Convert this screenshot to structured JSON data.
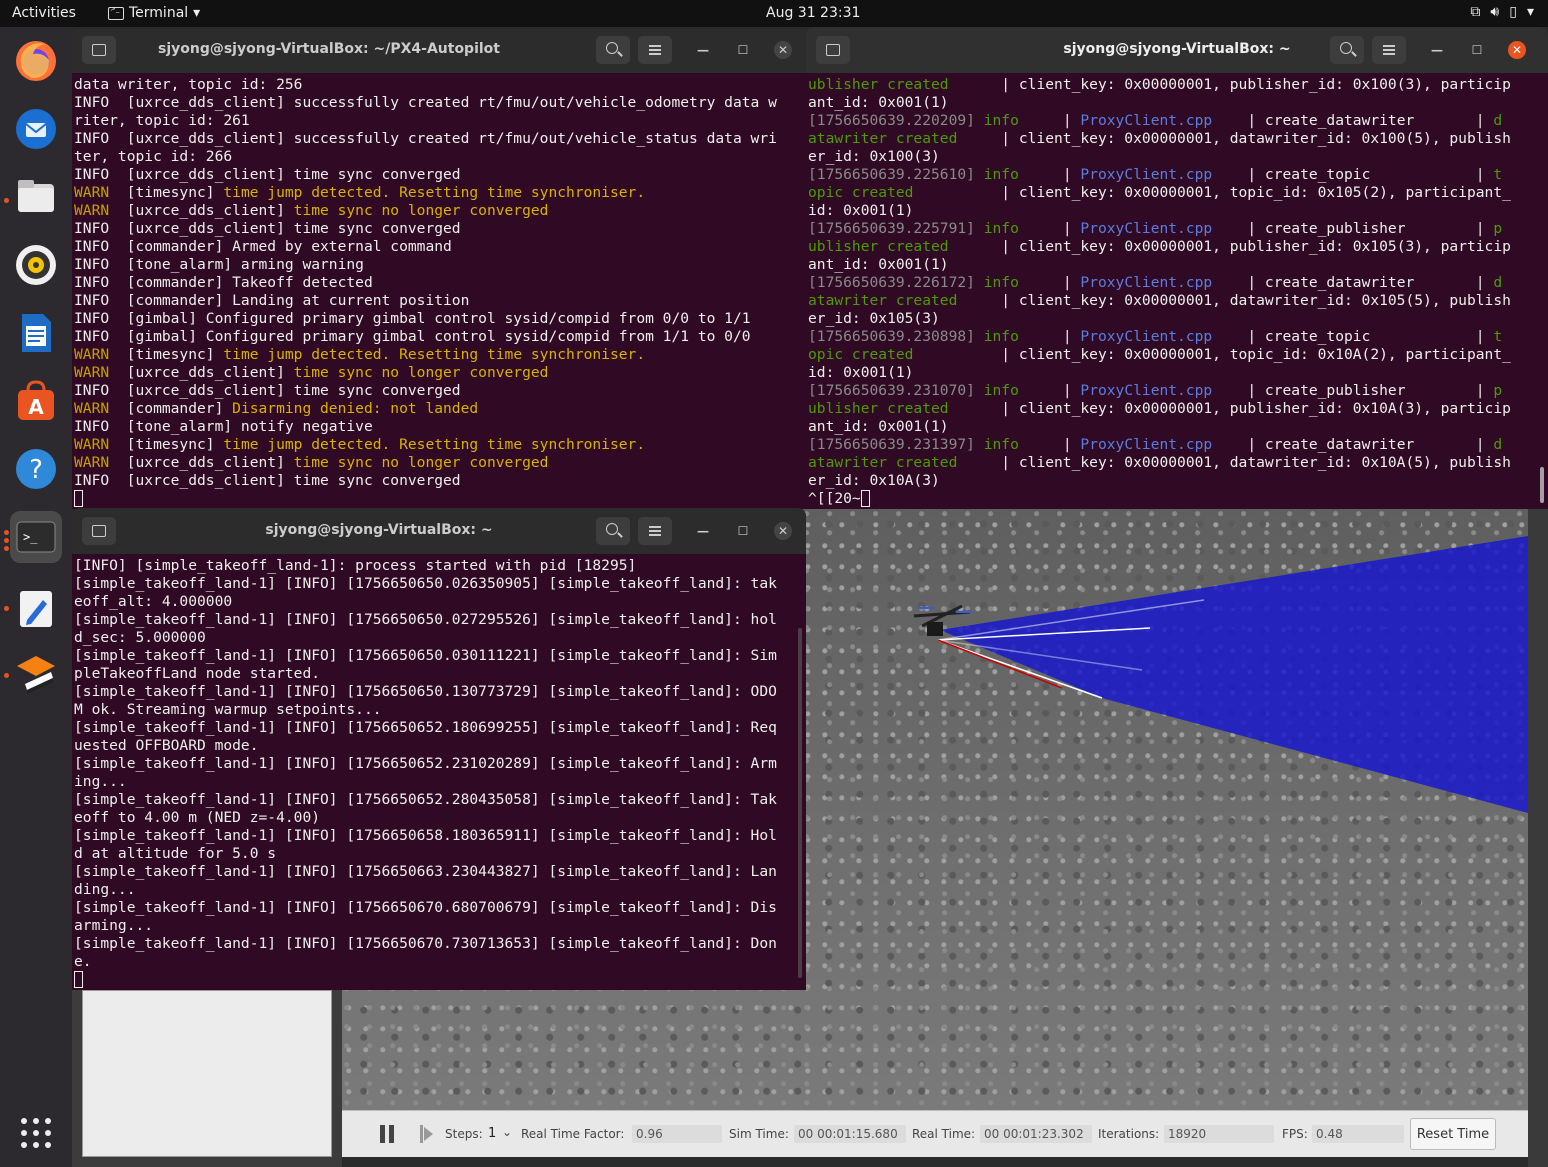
{
  "topbar": {
    "activities": "Activities",
    "app_menu": "Terminal",
    "clock": "Aug 31  23:31"
  },
  "dock": {
    "items": [
      "firefox-icon",
      "thunderbird-icon",
      "files-icon",
      "rhythmbox-icon",
      "libreoffice-writer-icon",
      "app-center-icon",
      "help-icon",
      "terminal-icon",
      "text-editor-icon",
      "gazebo-icon",
      "show-apps-icon"
    ]
  },
  "term1": {
    "title": "sjyong@sjyong-VirtualBox: ~/PX4-Autopilot",
    "lines": [
      [
        {
          "t": "data writer, topic id: 256"
        }
      ],
      [
        {
          "t": "INFO  [uxrce_dds_client] successfully created rt/fmu/out/vehicle_odometry data w"
        }
      ],
      [
        {
          "t": "riter, topic id: 261"
        }
      ],
      [
        {
          "t": "INFO  [uxrce_dds_client] successfully created rt/fmu/out/vehicle_status data wri"
        }
      ],
      [
        {
          "t": "ter, topic id: 266"
        }
      ],
      [
        {
          "t": "INFO  [uxrce_dds_client] time sync converged"
        }
      ],
      [
        {
          "t": "WARN  ",
          "c": "w"
        },
        {
          "t": "[timesync] "
        },
        {
          "t": "time jump detected. Resetting time synchroniser.",
          "c": "y"
        }
      ],
      [
        {
          "t": "WARN  ",
          "c": "w"
        },
        {
          "t": "[uxrce_dds_client] "
        },
        {
          "t": "time sync no longer converged",
          "c": "y"
        }
      ],
      [
        {
          "t": "INFO  [uxrce_dds_client] time sync converged"
        }
      ],
      [
        {
          "t": "INFO  [commander] Armed by external command"
        }
      ],
      [
        {
          "t": "INFO  [tone_alarm] arming warning"
        }
      ],
      [
        {
          "t": "INFO  [commander] Takeoff detected"
        }
      ],
      [
        {
          "t": "INFO  [commander] Landing at current position"
        }
      ],
      [
        {
          "t": "INFO  [gimbal] Configured primary gimbal control sysid/compid from 0/0 to 1/1"
        }
      ],
      [
        {
          "t": "INFO  [gimbal] Configured primary gimbal control sysid/compid from 1/1 to 0/0"
        }
      ],
      [
        {
          "t": "WARN  ",
          "c": "w"
        },
        {
          "t": "[timesync] "
        },
        {
          "t": "time jump detected. Resetting time synchroniser.",
          "c": "y"
        }
      ],
      [
        {
          "t": "WARN  ",
          "c": "w"
        },
        {
          "t": "[uxrce_dds_client] "
        },
        {
          "t": "time sync no longer converged",
          "c": "y"
        }
      ],
      [
        {
          "t": "INFO  [uxrce_dds_client] time sync converged"
        }
      ],
      [
        {
          "t": "WARN  ",
          "c": "w"
        },
        {
          "t": "[commander] "
        },
        {
          "t": "Disarming denied: not landed",
          "c": "y"
        }
      ],
      [
        {
          "t": "INFO  [tone_alarm] notify negative"
        }
      ],
      [
        {
          "t": "WARN  ",
          "c": "w"
        },
        {
          "t": "[timesync] "
        },
        {
          "t": "time jump detected. Resetting time synchroniser.",
          "c": "y"
        }
      ],
      [
        {
          "t": "WARN  ",
          "c": "w"
        },
        {
          "t": "[uxrce_dds_client] "
        },
        {
          "t": "time sync no longer converged",
          "c": "y"
        }
      ],
      [
        {
          "t": "INFO  [uxrce_dds_client] time sync converged"
        }
      ]
    ]
  },
  "term2": {
    "title": "sjyong@sjyong-VirtualBox: ~",
    "lines": [
      [
        {
          "t": "ublisher created",
          "c": "gn"
        },
        {
          "t": "      | client_key: 0x00000001, publisher_id: 0x100(3), particip"
        }
      ],
      [
        {
          "t": "ant_id: 0x001(1)"
        }
      ],
      [
        {
          "t": "[1756650639.220209]",
          "c": "g"
        },
        {
          "t": " "
        },
        {
          "t": "info",
          "c": "gn"
        },
        {
          "t": "     | "
        },
        {
          "t": "ProxyClient.cpp",
          "c": "bl"
        },
        {
          "t": "    | create_datawriter       | "
        },
        {
          "t": "d",
          "c": "gn"
        }
      ],
      [
        {
          "t": "atawriter created",
          "c": "gn"
        },
        {
          "t": "     | client_key: 0x00000001, datawriter_id: 0x100(5), publish"
        }
      ],
      [
        {
          "t": "er_id: 0x100(3)"
        }
      ],
      [
        {
          "t": "[1756650639.225610]",
          "c": "g"
        },
        {
          "t": " "
        },
        {
          "t": "info",
          "c": "gn"
        },
        {
          "t": "     | "
        },
        {
          "t": "ProxyClient.cpp",
          "c": "bl"
        },
        {
          "t": "    | create_topic            | "
        },
        {
          "t": "t",
          "c": "gn"
        }
      ],
      [
        {
          "t": "opic created",
          "c": "gn"
        },
        {
          "t": "          | client_key: 0x00000001, topic_id: 0x105(2), participant_"
        }
      ],
      [
        {
          "t": "id: 0x001(1)"
        }
      ],
      [
        {
          "t": "[1756650639.225791]",
          "c": "g"
        },
        {
          "t": " "
        },
        {
          "t": "info",
          "c": "gn"
        },
        {
          "t": "     | "
        },
        {
          "t": "ProxyClient.cpp",
          "c": "bl"
        },
        {
          "t": "    | create_publisher        | "
        },
        {
          "t": "p",
          "c": "gn"
        }
      ],
      [
        {
          "t": "ublisher created",
          "c": "gn"
        },
        {
          "t": "      | client_key: 0x00000001, publisher_id: 0x105(3), particip"
        }
      ],
      [
        {
          "t": "ant_id: 0x001(1)"
        }
      ],
      [
        {
          "t": "[1756650639.226172]",
          "c": "g"
        },
        {
          "t": " "
        },
        {
          "t": "info",
          "c": "gn"
        },
        {
          "t": "     | "
        },
        {
          "t": "ProxyClient.cpp",
          "c": "bl"
        },
        {
          "t": "    | create_datawriter       | "
        },
        {
          "t": "d",
          "c": "gn"
        }
      ],
      [
        {
          "t": "atawriter created",
          "c": "gn"
        },
        {
          "t": "     | client_key: 0x00000001, datawriter_id: 0x105(5), publish"
        }
      ],
      [
        {
          "t": "er_id: 0x105(3)"
        }
      ],
      [
        {
          "t": "[1756650639.230898]",
          "c": "g"
        },
        {
          "t": " "
        },
        {
          "t": "info",
          "c": "gn"
        },
        {
          "t": "     | "
        },
        {
          "t": "ProxyClient.cpp",
          "c": "bl"
        },
        {
          "t": "    | create_topic            | "
        },
        {
          "t": "t",
          "c": "gn"
        }
      ],
      [
        {
          "t": "opic created",
          "c": "gn"
        },
        {
          "t": "          | client_key: 0x00000001, topic_id: 0x10A(2), participant_"
        }
      ],
      [
        {
          "t": "id: 0x001(1)"
        }
      ],
      [
        {
          "t": "[1756650639.231070]",
          "c": "g"
        },
        {
          "t": " "
        },
        {
          "t": "info",
          "c": "gn"
        },
        {
          "t": "     | "
        },
        {
          "t": "ProxyClient.cpp",
          "c": "bl"
        },
        {
          "t": "    | create_publisher        | "
        },
        {
          "t": "p",
          "c": "gn"
        }
      ],
      [
        {
          "t": "ublisher created",
          "c": "gn"
        },
        {
          "t": "      | client_key: 0x00000001, publisher_id: 0x10A(3), particip"
        }
      ],
      [
        {
          "t": "ant_id: 0x001(1)"
        }
      ],
      [
        {
          "t": "[1756650639.231397]",
          "c": "g"
        },
        {
          "t": " "
        },
        {
          "t": "info",
          "c": "gn"
        },
        {
          "t": "     | "
        },
        {
          "t": "ProxyClient.cpp",
          "c": "bl"
        },
        {
          "t": "    | create_datawriter       | "
        },
        {
          "t": "d",
          "c": "gn"
        }
      ],
      [
        {
          "t": "atawriter created",
          "c": "gn"
        },
        {
          "t": "     | client_key: 0x00000001, datawriter_id: 0x10A(5), publish"
        }
      ],
      [
        {
          "t": "er_id: 0x10A(3)"
        }
      ],
      [
        {
          "t": "^[[20~"
        }
      ]
    ]
  },
  "term3": {
    "title": "sjyong@sjyong-VirtualBox: ~",
    "lines": [
      [
        {
          "t": "[INFO] [simple_takeoff_land-1]: process started with pid [18295]"
        }
      ],
      [
        {
          "t": "[simple_takeoff_land-1] [INFO] [1756650650.026350905] [simple_takeoff_land]: tak"
        }
      ],
      [
        {
          "t": "eoff_alt: 4.000000"
        }
      ],
      [
        {
          "t": "[simple_takeoff_land-1] [INFO] [1756650650.027295526] [simple_takeoff_land]: hol"
        }
      ],
      [
        {
          "t": "d_sec: 5.000000"
        }
      ],
      [
        {
          "t": "[simple_takeoff_land-1] [INFO] [1756650650.030111221] [simple_takeoff_land]: Sim"
        }
      ],
      [
        {
          "t": "pleTakeoffLand node started."
        }
      ],
      [
        {
          "t": "[simple_takeoff_land-1] [INFO] [1756650650.130773729] [simple_takeoff_land]: ODO"
        }
      ],
      [
        {
          "t": "M ok. Streaming warmup setpoints..."
        }
      ],
      [
        {
          "t": "[simple_takeoff_land-1] [INFO] [1756650652.180699255] [simple_takeoff_land]: Req"
        }
      ],
      [
        {
          "t": "uested OFFBOARD mode."
        }
      ],
      [
        {
          "t": "[simple_takeoff_land-1] [INFO] [1756650652.231020289] [simple_takeoff_land]: Arm"
        }
      ],
      [
        {
          "t": "ing..."
        }
      ],
      [
        {
          "t": "[simple_takeoff_land-1] [INFO] [1756650652.280435058] [simple_takeoff_land]: Tak"
        }
      ],
      [
        {
          "t": "eoff to 4.00 m (NED z=-4.00)"
        }
      ],
      [
        {
          "t": "[simple_takeoff_land-1] [INFO] [1756650658.180365911] [simple_takeoff_land]: Hol"
        }
      ],
      [
        {
          "t": "d at altitude for 5.0 s"
        }
      ],
      [
        {
          "t": "[simple_takeoff_land-1] [INFO] [1756650663.230443827] [simple_takeoff_land]: Lan"
        }
      ],
      [
        {
          "t": "ding..."
        }
      ],
      [
        {
          "t": "[simple_takeoff_land-1] [INFO] [1756650670.680700679] [simple_takeoff_land]: Dis"
        }
      ],
      [
        {
          "t": "arming..."
        }
      ],
      [
        {
          "t": "[simple_takeoff_land-1] [INFO] [1756650670.730713653] [simple_takeoff_land]: Don"
        }
      ],
      [
        {
          "t": "e."
        }
      ]
    ]
  },
  "gazebo": {
    "steps_label": "Steps:",
    "steps_value": "1",
    "rtf_label": "Real Time Factor:",
    "rtf_value": "0.96",
    "sim_time_label": "Sim Time:",
    "sim_time_value": "00 00:01:15.680",
    "real_time_label": "Real Time:",
    "real_time_value": "00 00:01:23.302",
    "iterations_label": "Iterations:",
    "iterations_value": "18920",
    "fps_label": "FPS:",
    "fps_value": "0.48",
    "reset_label": "Reset Time"
  }
}
